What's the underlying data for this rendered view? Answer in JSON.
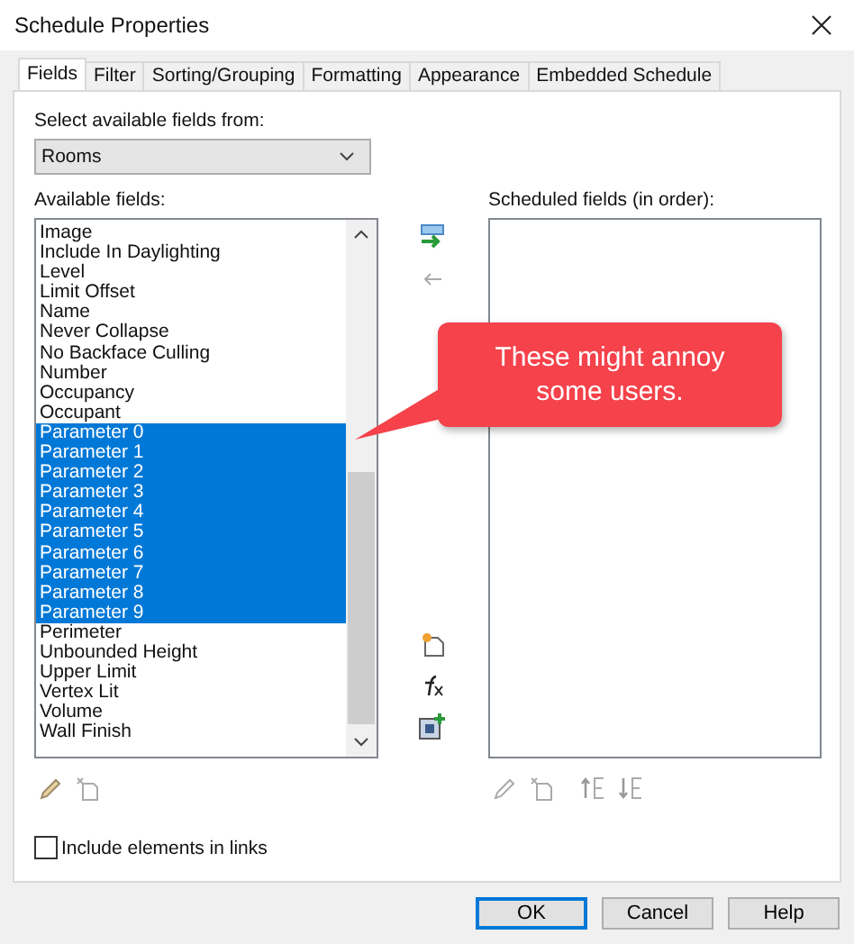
{
  "window": {
    "title": "Schedule Properties"
  },
  "tabs": [
    {
      "label": "Fields",
      "selected": true
    },
    {
      "label": "Filter",
      "selected": false
    },
    {
      "label": "Sorting/Grouping",
      "selected": false
    },
    {
      "label": "Formatting",
      "selected": false
    },
    {
      "label": "Appearance",
      "selected": false
    },
    {
      "label": "Embedded Schedule",
      "selected": false
    }
  ],
  "source": {
    "label": "Select available fields from:",
    "value": "Rooms"
  },
  "available": {
    "label": "Available fields:",
    "items": [
      {
        "text": "Image",
        "selected": false
      },
      {
        "text": "Include In Daylighting",
        "selected": false
      },
      {
        "text": "Level",
        "selected": false
      },
      {
        "text": "Limit Offset",
        "selected": false
      },
      {
        "text": "Name",
        "selected": false
      },
      {
        "text": "Never Collapse",
        "selected": false
      },
      {
        "text": "No Backface Culling",
        "selected": false
      },
      {
        "text": "Number",
        "selected": false
      },
      {
        "text": "Occupancy",
        "selected": false
      },
      {
        "text": "Occupant",
        "selected": false
      },
      {
        "text": "Parameter 0",
        "selected": true
      },
      {
        "text": "Parameter 1",
        "selected": true
      },
      {
        "text": "Parameter 2",
        "selected": true
      },
      {
        "text": "Parameter 3",
        "selected": true
      },
      {
        "text": "Parameter 4",
        "selected": true
      },
      {
        "text": "Parameter 5",
        "selected": true
      },
      {
        "text": "Parameter 6",
        "selected": true
      },
      {
        "text": "Parameter 7",
        "selected": true
      },
      {
        "text": "Parameter 8",
        "selected": true
      },
      {
        "text": "Parameter 9",
        "selected": true
      },
      {
        "text": "Perimeter",
        "selected": false
      },
      {
        "text": "Unbounded Height",
        "selected": false
      },
      {
        "text": "Upper Limit",
        "selected": false
      },
      {
        "text": "Vertex Lit",
        "selected": false
      },
      {
        "text": "Volume",
        "selected": false
      },
      {
        "text": "Wall Finish",
        "selected": false
      }
    ]
  },
  "scheduled": {
    "label": "Scheduled fields (in order):"
  },
  "include_links": {
    "label": "Include elements in links",
    "checked": false
  },
  "callout": {
    "text": "These might annoy some users."
  },
  "buttons": [
    {
      "label": "OK",
      "default": true
    },
    {
      "label": "Cancel",
      "default": false
    },
    {
      "label": "Help",
      "default": false
    }
  ]
}
